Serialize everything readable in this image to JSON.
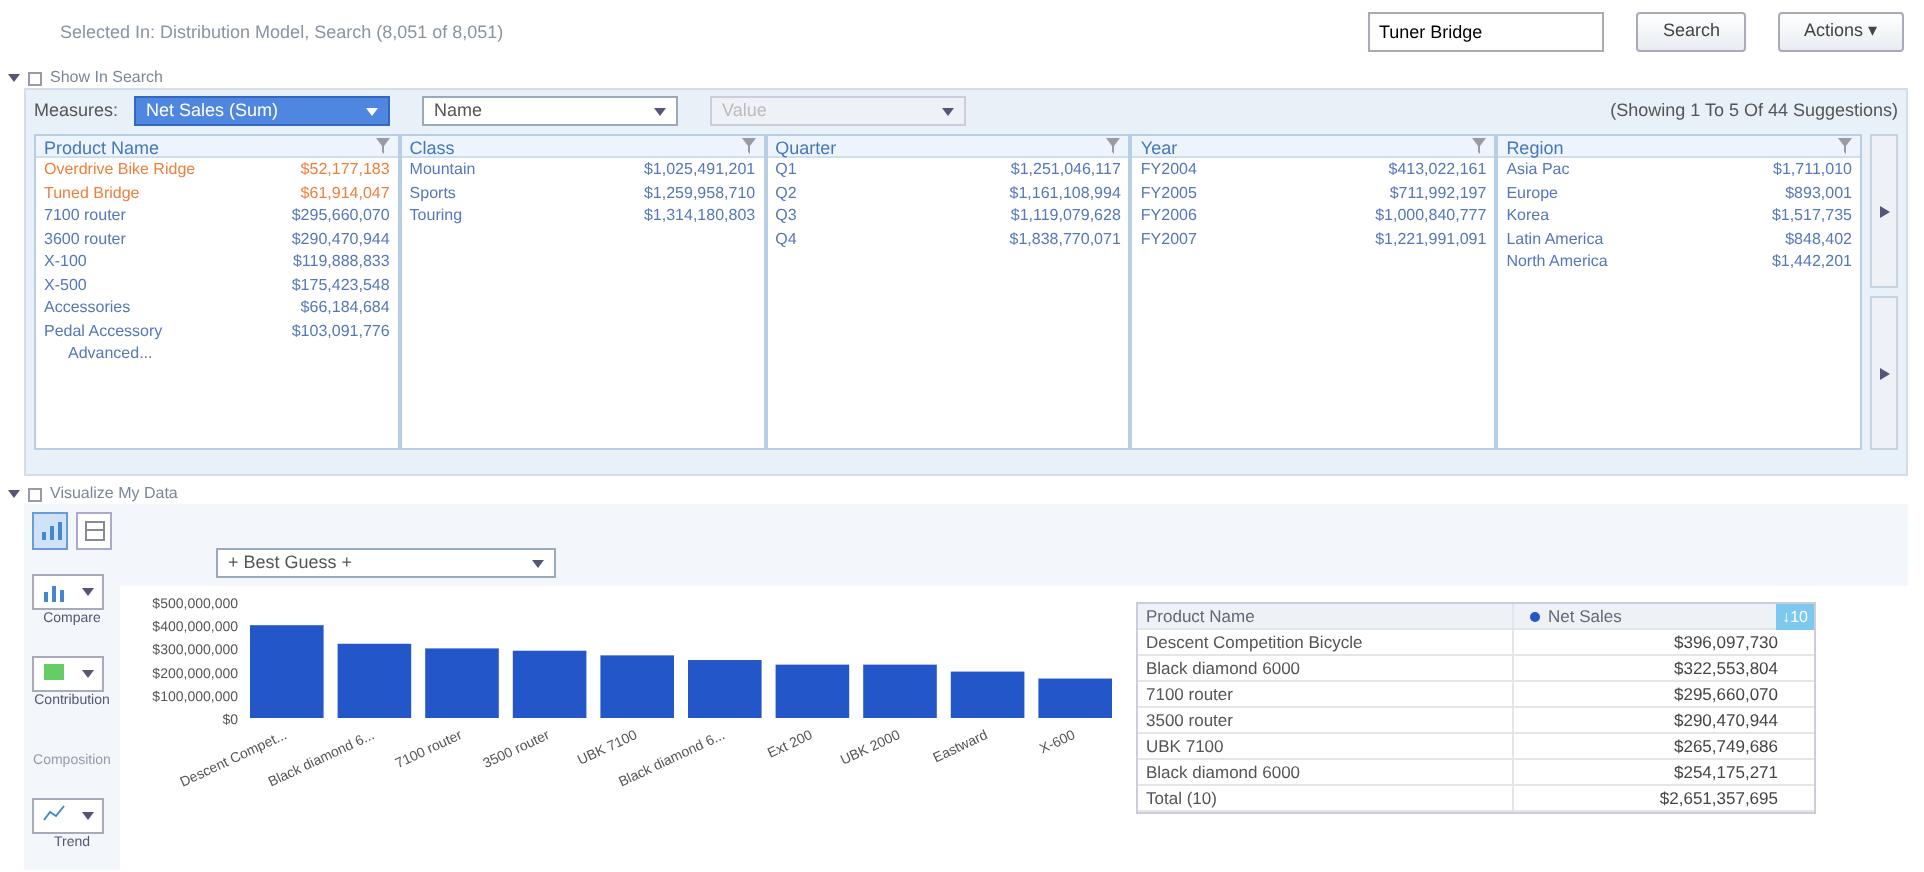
{
  "breadcrumb": "Selected In: Distribution Model, Search (8,051 of 8,051)",
  "search": {
    "value": "Tuner Bridge"
  },
  "search_button": "Search",
  "actions_button": {
    "label": "Actions",
    "caret": "▾"
  },
  "search_section": {
    "title": "Show In Search",
    "expanded": true
  },
  "measures": {
    "label": "Measures:",
    "dropdowns": [
      {
        "value": "Net Sales (Sum)",
        "highlighted": true,
        "disabled": false
      },
      {
        "value": "Name",
        "highlighted": false,
        "disabled": false
      },
      {
        "value": "Value",
        "highlighted": false,
        "disabled": true
      }
    ]
  },
  "showing": "(Showing 1 To 5 Of 44 Suggestions)",
  "facets": [
    {
      "title": "Product Name",
      "items": [
        {
          "label": "Overdrive Bike Ridge",
          "value": "$52,177,183",
          "selected": true
        },
        {
          "label": "Tuned Bridge",
          "value": "$61,914,047",
          "selected": true
        },
        {
          "label": "7100 router",
          "value": "$295,660,070",
          "selected": false
        },
        {
          "label": "3600 router",
          "value": "$290,470,944",
          "selected": false
        },
        {
          "label": "X-100",
          "value": "$119,888,833",
          "selected": false
        },
        {
          "label": "X-500",
          "value": "$175,423,548",
          "selected": false
        },
        {
          "label": "Accessories",
          "value": "$66,184,684",
          "selected": false
        },
        {
          "label": "Pedal Accessory",
          "value": "$103,091,776",
          "selected": false
        }
      ],
      "more": "Advanced..."
    },
    {
      "title": "Class",
      "items": [
        {
          "label": "Mountain",
          "value": "$1,025,491,201",
          "selected": false
        },
        {
          "label": "Sports",
          "value": "$1,259,958,710",
          "selected": false
        },
        {
          "label": "Touring",
          "value": "$1,314,180,803",
          "selected": false
        }
      ]
    },
    {
      "title": "Quarter",
      "items": [
        {
          "label": "Q1",
          "value": "$1,251,046,117",
          "selected": false
        },
        {
          "label": "Q2",
          "value": "$1,161,108,994",
          "selected": false
        },
        {
          "label": "Q3",
          "value": "$1,119,079,628",
          "selected": false
        },
        {
          "label": "Q4",
          "value": "$1,838,770,071",
          "selected": false
        }
      ]
    },
    {
      "title": "Year",
      "items": [
        {
          "label": "FY2004",
          "value": "$413,022,161",
          "selected": false
        },
        {
          "label": "FY2005",
          "value": "$711,992,197",
          "selected": false
        },
        {
          "label": "FY2006",
          "value": "$1,000,840,777",
          "selected": false
        },
        {
          "label": "FY2007",
          "value": "$1,221,991,091",
          "selected": false
        }
      ]
    },
    {
      "title": "Region",
      "items": [
        {
          "label": "Asia Pac",
          "value": "$1,711,010",
          "selected": false
        },
        {
          "label": "Europe",
          "value": "$893,001",
          "selected": false
        },
        {
          "label": "Korea",
          "value": "$1,517,735",
          "selected": false
        },
        {
          "label": "Latin America",
          "value": "$848,402",
          "selected": false
        },
        {
          "label": "North America",
          "value": "$1,442,201",
          "selected": false
        }
      ]
    }
  ],
  "viz_section": {
    "title": "Visualize My Data",
    "expanded": true
  },
  "view_toggle": [
    {
      "kind": "chart",
      "selected": true
    },
    {
      "kind": "table",
      "selected": false
    }
  ],
  "tools": [
    {
      "kind": "bar",
      "label": "Compare",
      "disabled": false
    },
    {
      "kind": "pie",
      "label": "Contribution",
      "disabled": false
    },
    {
      "kind": "blank",
      "label": "Composition",
      "disabled": true
    },
    {
      "kind": "trend",
      "label": "Trend",
      "disabled": false
    }
  ],
  "guess_dropdown": "+ Best Guess +",
  "chart_data": {
    "type": "bar",
    "categories": [
      "Descent Compet...",
      "Black diamond 6...",
      "7100 router",
      "3500 router",
      "UBK 7100",
      "Black diamond 6...",
      "Ext 200",
      "UBK 2000",
      "Eastward",
      "X-600"
    ],
    "values": [
      400000000,
      320000000,
      300000000,
      290000000,
      270000000,
      250000000,
      230000000,
      230000000,
      200000000,
      170000000
    ],
    "ylim": [
      0,
      500000000
    ],
    "yticks": [
      {
        "value": 0,
        "label": "$0"
      },
      {
        "value": 100000000,
        "label": "$100,000,000"
      },
      {
        "value": 200000000,
        "label": "$200,000,000"
      },
      {
        "value": 300000000,
        "label": "$300,000,000"
      },
      {
        "value": 400000000,
        "label": "$400,000,000"
      },
      {
        "value": 500000000,
        "label": "$500,000,000"
      }
    ]
  },
  "table": {
    "columns": [
      "Product Name",
      "Net Sales"
    ],
    "sort": "↓10",
    "rows": [
      [
        "Descent Competition Bicycle",
        "$396,097,730"
      ],
      [
        "Black diamond 6000",
        "$322,553,804"
      ],
      [
        "7100 router",
        "$295,660,070"
      ],
      [
        "3500 router",
        "$290,470,944"
      ],
      [
        "UBK 7100",
        "$265,749,686"
      ],
      [
        "Black diamond 6000",
        "$254,175,271"
      ]
    ],
    "total": [
      "Total (10)",
      "$2,651,357,695"
    ]
  }
}
